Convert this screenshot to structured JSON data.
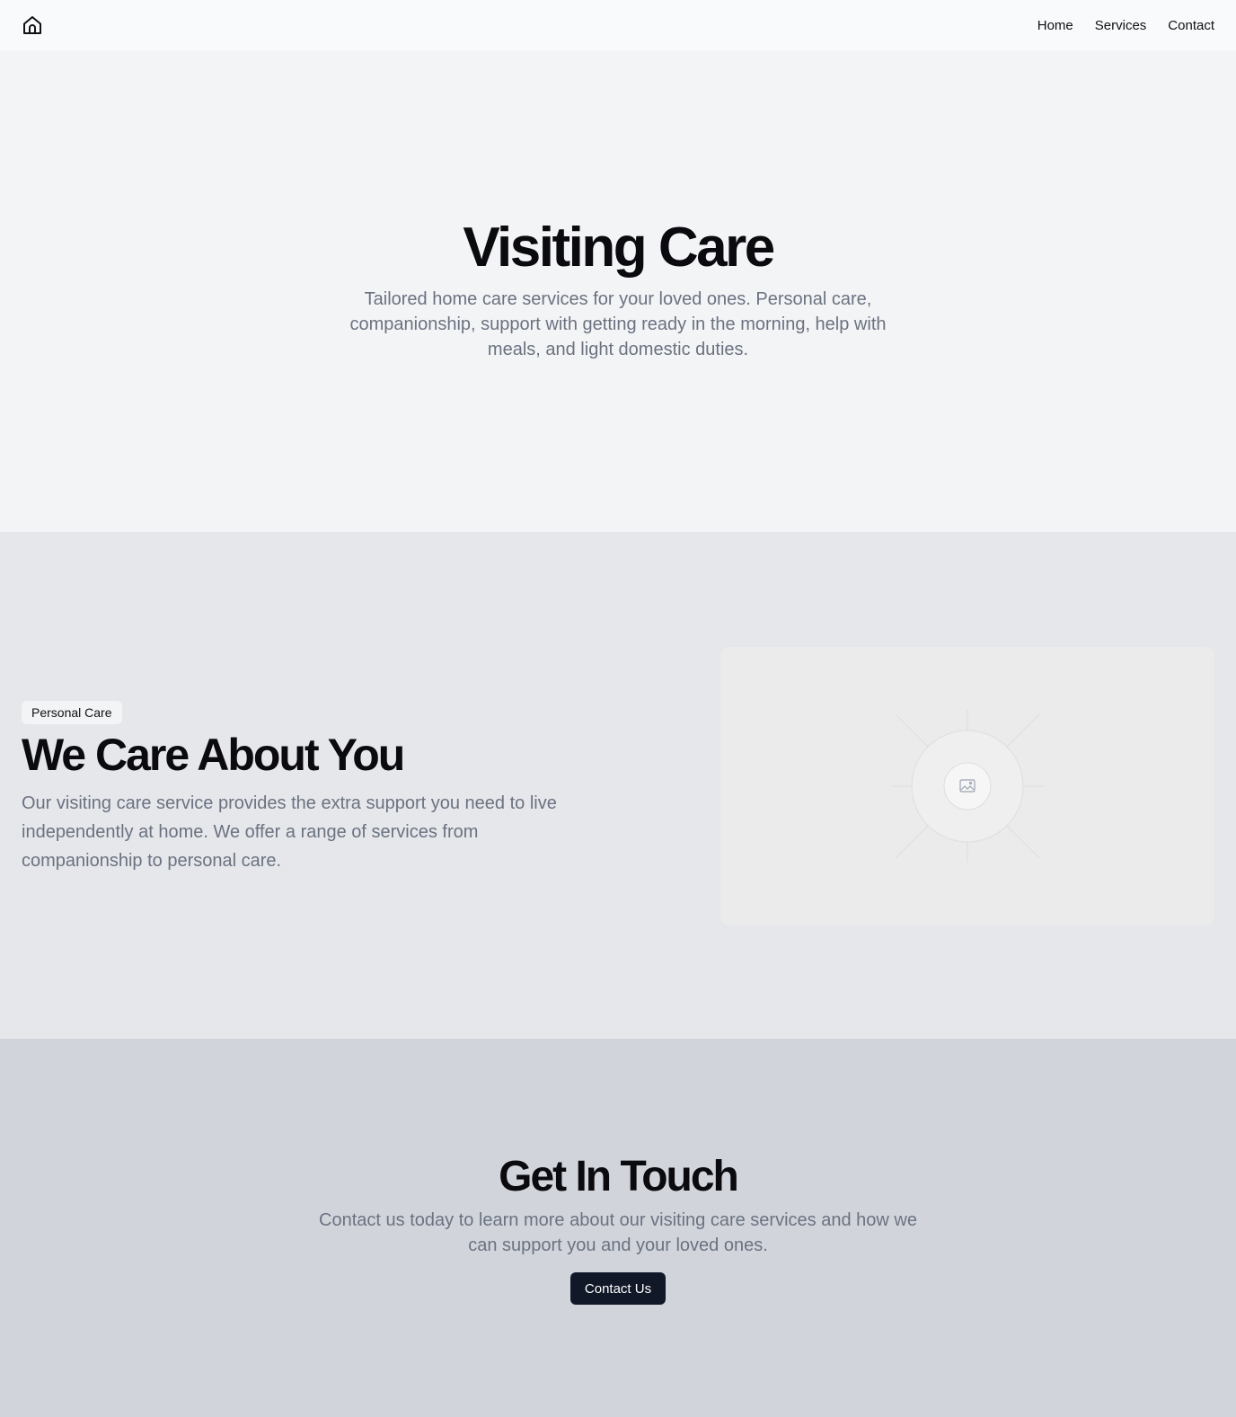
{
  "header": {
    "logo_icon": "home-icon",
    "nav": [
      {
        "label": "Home"
      },
      {
        "label": "Services"
      },
      {
        "label": "Contact"
      }
    ]
  },
  "hero": {
    "title": "Visiting Care",
    "subtitle": "Tailored home care services for your loved ones. Personal care, companionship, support with getting ready in the morning, help with meals, and light domestic duties."
  },
  "about": {
    "badge": "Personal Care",
    "title": "We Care About You",
    "body": "Our visiting care service provides the extra support you need to live independently at home. We offer a range of services from companionship to personal care.",
    "image_icon": "image-icon"
  },
  "contact": {
    "title": "Get In Touch",
    "body": "Contact us today to learn more about our visiting care services and how we can support you and your loved ones.",
    "button_label": "Contact Us"
  },
  "colors": {
    "header_bg": "#f9fafb",
    "hero_bg": "#f3f4f6",
    "about_bg": "#e5e7eb",
    "contact_bg": "#d1d5db",
    "muted_text": "#6b7280",
    "button_bg": "#111827"
  }
}
